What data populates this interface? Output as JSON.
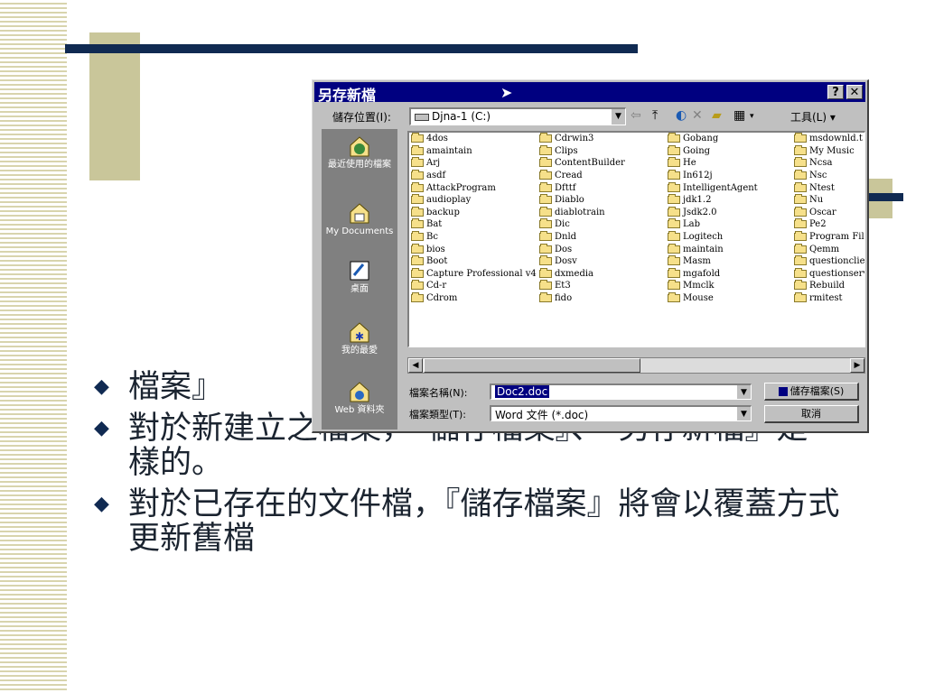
{
  "slide": {
    "bullets": [
      "檔案』",
      "對於新建立之檔案，『儲存檔案』、『另存新檔』是一樣的。",
      "對於已存在的文件檔，『儲存檔案』將會以覆蓋方式更新舊檔"
    ]
  },
  "dialog": {
    "title": "另存新檔",
    "help_label": "?",
    "close_label": "✕",
    "location_label": "儲存位置(I):",
    "location_value": "Djna-1 (C:)",
    "toolbar": {
      "back_icon": "back-arrow-icon",
      "up_icon": "up-folder-icon",
      "search_icon": "search-web-icon",
      "delete_icon": "delete-icon",
      "new_folder_icon": "new-folder-icon",
      "views_icon": "views-icon",
      "tools_label": "工具(L) ▾"
    },
    "sidebar": [
      {
        "label": "最近使用的檔案",
        "icon": "history-icon"
      },
      {
        "label": "My Documents",
        "icon": "my-documents-icon"
      },
      {
        "label": "桌面",
        "icon": "desktop-icon"
      },
      {
        "label": "我的最愛",
        "icon": "favorites-icon"
      },
      {
        "label": "Web 資料夾",
        "icon": "web-folders-icon"
      }
    ],
    "files": [
      [
        "4dos",
        "amaintain",
        "Arj",
        "asdf",
        "AttackProgram",
        "audioplay",
        "backup",
        "Bat",
        "Bc",
        "bios",
        "Boot",
        "Capture Professional v4",
        "Cd-r",
        "Cdrom"
      ],
      [
        "Cdrwin3",
        "Clips",
        "ContentBuilder",
        "Cread",
        "Dfttf",
        "Diablo",
        "diablotrain",
        "Dic",
        "Dnld",
        "Dos",
        "Dosv",
        "dxmedia",
        "Et3",
        "fido"
      ],
      [
        "Gobang",
        "Going",
        "He",
        "In612j",
        "IntelligentAgent",
        "jdk1.2",
        "Jsdk2.0",
        "Lab",
        "Logitech",
        "maintain",
        "Masm",
        "mgafold",
        "Mmclk",
        "Mouse"
      ],
      [
        "msdownld.t",
        "My Music",
        "Ncsa",
        "Nsc",
        "Ntest",
        "Nu",
        "Oscar",
        "Pe2",
        "Program Fil",
        "Qemm",
        "questionclie",
        "questionserv",
        "Rebuild",
        "rmitest"
      ]
    ],
    "filename_label": "檔案名稱(N):",
    "filename_value": "Doc2.doc",
    "filetype_label": "檔案類型(T):",
    "filetype_value": "Word 文件 (*.doc)",
    "save_button": "儲存檔案(S)",
    "cancel_button": "取消"
  },
  "colors": {
    "titlebar": "#000080",
    "navy": "#102a52",
    "olive": "#c9c69a"
  }
}
